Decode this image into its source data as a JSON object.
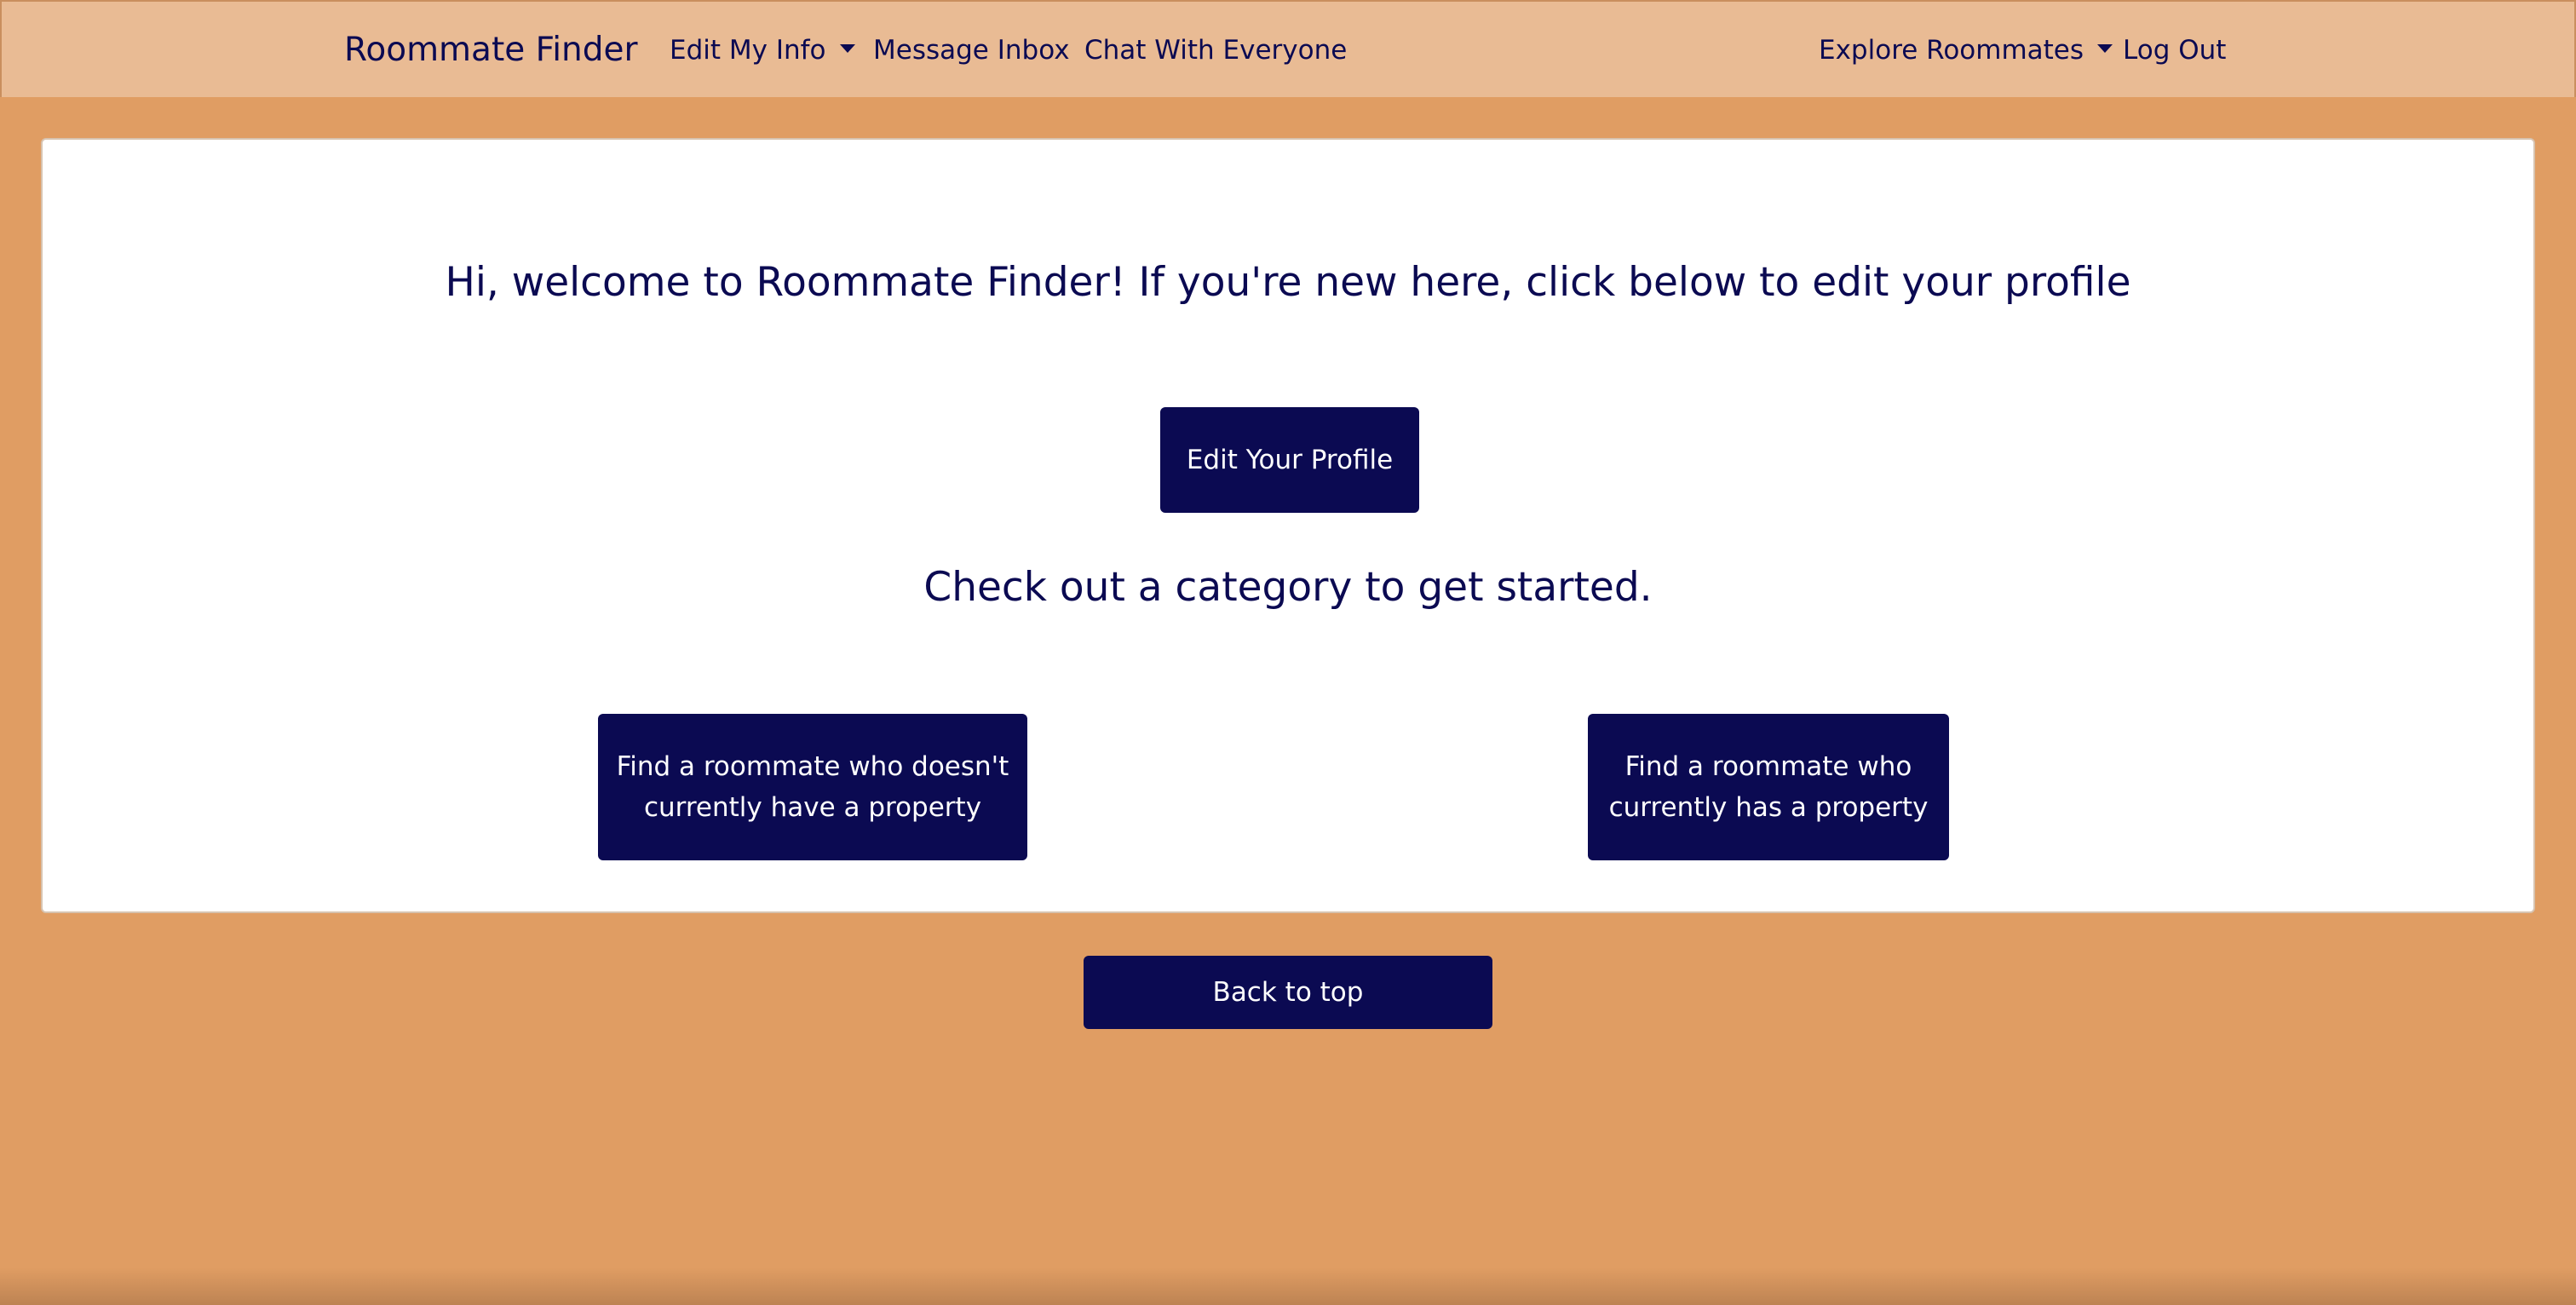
{
  "navbar": {
    "brand": "Roommate Finder",
    "left_links": [
      {
        "label": "Edit My Info",
        "dropdown": true
      },
      {
        "label": "Message Inbox",
        "dropdown": false
      },
      {
        "label": "Chat With Everyone",
        "dropdown": false
      }
    ],
    "right_links": [
      {
        "label": "Explore Roommates",
        "dropdown": true
      },
      {
        "label": "Log Out",
        "dropdown": false
      }
    ]
  },
  "main": {
    "welcome": "Hi, welcome to Roommate Finder! If you're new here, click below to edit your profile",
    "edit_profile_label": "Edit Your Profile",
    "category_heading": "Check out a category to get started.",
    "categories": [
      {
        "label": "Find a roommate who doesn't currently have a property"
      },
      {
        "label": "Find a roommate who currently has a property"
      }
    ]
  },
  "footer": {
    "back_to_top_label": "Back to top"
  },
  "colors": {
    "navbar_bg": "#e9bb94",
    "page_bg": "#e09d63",
    "primary": "#0b0a52",
    "card_bg": "#ffffff"
  }
}
